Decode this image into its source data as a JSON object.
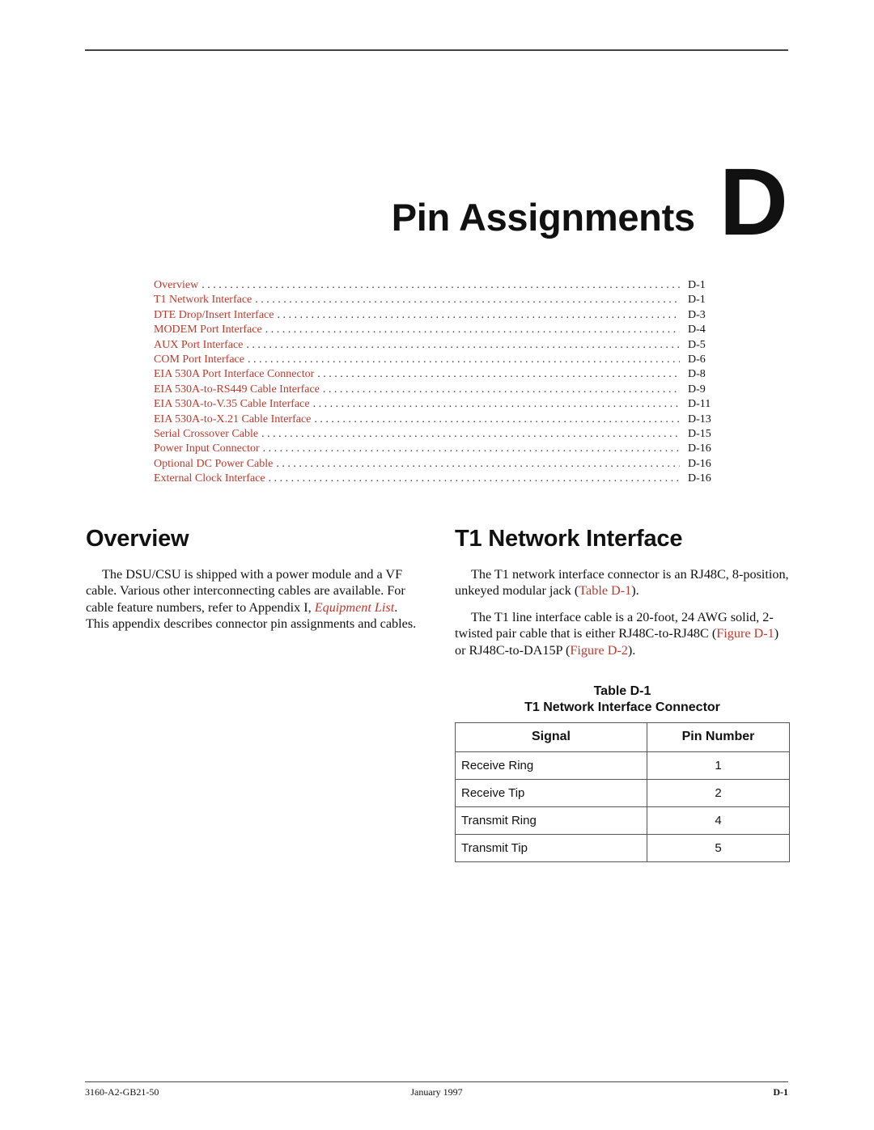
{
  "chapter": {
    "title": "Pin Assignments",
    "letter": "D"
  },
  "toc": [
    {
      "label": "Overview",
      "page": "D-1"
    },
    {
      "label": "T1 Network Interface",
      "page": "D-1"
    },
    {
      "label": "DTE Drop/Insert Interface",
      "page": "D-3"
    },
    {
      "label": "MODEM Port Interface",
      "page": "D-4"
    },
    {
      "label": "AUX Port Interface",
      "page": "D-5"
    },
    {
      "label": "COM Port Interface",
      "page": "D-6"
    },
    {
      "label": "EIA 530A Port Interface Connector",
      "page": "D-8"
    },
    {
      "label": "EIA 530A-to-RS449 Cable Interface",
      "page": "D-9"
    },
    {
      "label": "EIA 530A-to-V.35 Cable Interface",
      "page": "D-11"
    },
    {
      "label": "EIA 530A-to-X.21 Cable Interface",
      "page": "D-13"
    },
    {
      "label": "Serial Crossover Cable",
      "page": "D-15"
    },
    {
      "label": "Power Input Connector",
      "page": "D-16"
    },
    {
      "label": "Optional DC Power Cable",
      "page": "D-16"
    },
    {
      "label": "External Clock Interface",
      "page": "D-16"
    }
  ],
  "overview": {
    "heading": "Overview",
    "p1_before": "The DSU/CSU is shipped with a power module and a VF cable. Various other interconnecting cables are available. For cable feature numbers, refer to Appendix I, ",
    "p1_link": "Equipment List",
    "p1_after": ". This appendix describes connector pin assignments and cables."
  },
  "t1": {
    "heading": "T1 Network Interface",
    "p1_before": "The T1 network interface connector is an RJ48C, 8-position, unkeyed modular jack (",
    "p1_link": "Table D-1",
    "p1_after": ").",
    "p2_before": "The T1 line interface cable is a 20-foot, 24 AWG solid, 2-twisted pair cable that is either RJ48C-to-RJ48C (",
    "p2_link1": "Figure D-1",
    "p2_mid": ") or RJ48C-to-DA15P (",
    "p2_link2": "Figure D-2",
    "p2_after": ")."
  },
  "table": {
    "number": "Table D-1",
    "title": "T1 Network Interface Connector",
    "headers": [
      "Signal",
      "Pin Number"
    ],
    "rows": [
      {
        "signal": "Receive Ring",
        "pin": "1"
      },
      {
        "signal": "Receive Tip",
        "pin": "2"
      },
      {
        "signal": "Transmit Ring",
        "pin": "4"
      },
      {
        "signal": "Transmit Tip",
        "pin": "5"
      }
    ]
  },
  "footer": {
    "doc_id": "3160-A2-GB21-50",
    "date": "January 1997",
    "page": "D-1"
  },
  "colors": {
    "link": "#c0392b",
    "text": "#111111"
  }
}
